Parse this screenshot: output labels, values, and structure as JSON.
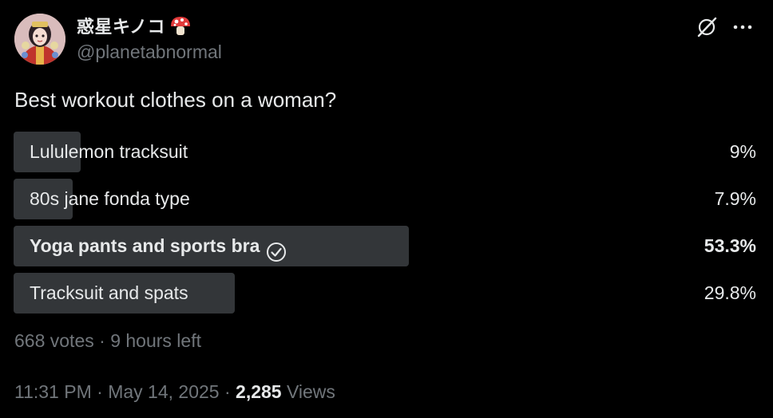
{
  "author": {
    "display_name": "惑星キノコ",
    "handle": "@planetabnormal",
    "avatar_icon": "avatar-image",
    "name_emoji_icon": "mushroom-icon"
  },
  "header_actions": {
    "grok_icon": "grok-icon",
    "more_icon": "more-icon"
  },
  "question": "Best workout clothes on a woman?",
  "poll": {
    "options": [
      {
        "label": "Lululemon tracksuit",
        "percent_text": "9%",
        "percent": 9,
        "winner": false
      },
      {
        "label": "80s jane fonda type",
        "percent_text": "7.9%",
        "percent": 7.9,
        "winner": false
      },
      {
        "label": "Yoga pants and sports bra",
        "percent_text": "53.3%",
        "percent": 53.3,
        "winner": true
      },
      {
        "label": "Tracksuit and spats",
        "percent_text": "29.8%",
        "percent": 29.8,
        "winner": false
      }
    ],
    "votes": "668 votes",
    "separator": "·",
    "time_left": "9 hours left"
  },
  "meta": {
    "time": "11:31 PM",
    "separator": "·",
    "date": "May 14, 2025",
    "views_count": "2,285",
    "views_label": "Views"
  },
  "colors": {
    "background": "#000000",
    "text_primary": "#e7e9ea",
    "text_secondary": "#71767b",
    "poll_bar": "#333639"
  }
}
